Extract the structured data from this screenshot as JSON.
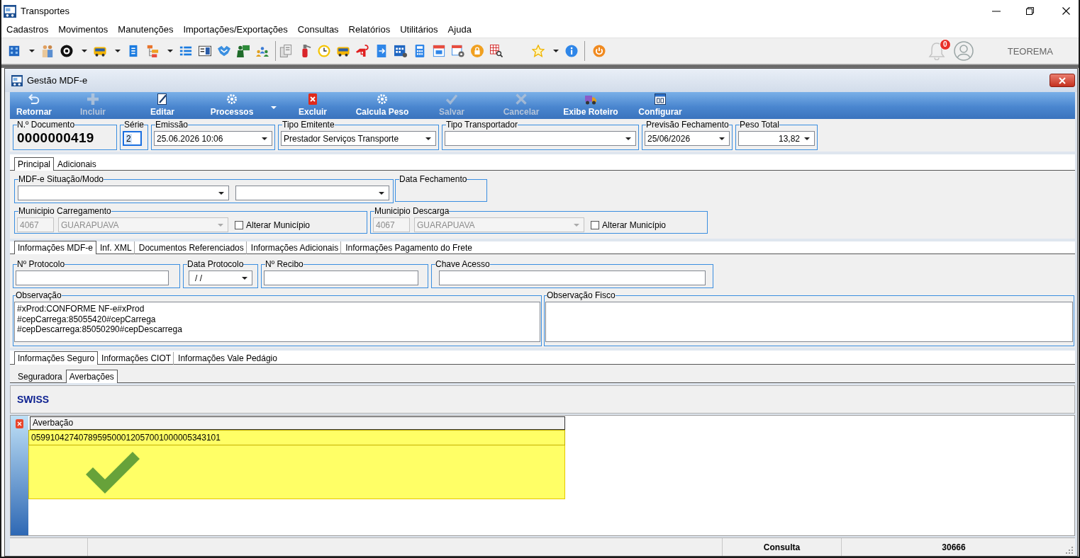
{
  "app": {
    "title": "Transportes",
    "menu": [
      "Cadastros",
      "Movimentos",
      "Manutenções",
      "Importações/Exportações",
      "Consultas",
      "Relatórios",
      "Utilitários",
      "Ajuda"
    ],
    "notification_count": "0",
    "user": "TEOREMA"
  },
  "window": {
    "title": "Gestão MDF-e"
  },
  "actions": [
    {
      "label": "Retornar",
      "kind": "button",
      "disabled": false
    },
    {
      "label": "Incluir",
      "kind": "button",
      "disabled": true
    },
    {
      "label": "Editar",
      "kind": "button",
      "disabled": false
    },
    {
      "label": "Processos",
      "kind": "menu",
      "disabled": false
    },
    {
      "label": "Excluir",
      "kind": "button",
      "disabled": false
    },
    {
      "label": "Calcula Peso",
      "kind": "button",
      "disabled": false
    },
    {
      "label": "Salvar",
      "kind": "button",
      "disabled": true
    },
    {
      "label": "Cancelar",
      "kind": "button",
      "disabled": true
    },
    {
      "label": "Exibe Roteiro",
      "kind": "button",
      "disabled": false
    },
    {
      "label": "Configurar",
      "kind": "button",
      "disabled": false
    }
  ],
  "header_fields": [
    {
      "label": "N.º Documento",
      "kind": "display",
      "value": "0000000419",
      "focused": false
    },
    {
      "label": "Série",
      "kind": "text",
      "value": "2",
      "focused": true
    },
    {
      "label": "Emissão",
      "kind": "combo",
      "value": "25.06.2026 10:06",
      "focused": false
    },
    {
      "label": "Tipo Emitente",
      "kind": "combo",
      "value": "Prestador Serviços Transporte",
      "focused": false
    },
    {
      "label": "Tipo Transportador",
      "kind": "combo",
      "focused": false
    },
    {
      "label": "Previsão Fechamento",
      "kind": "combo",
      "value": "25/06/2026",
      "focused": false
    },
    {
      "label": "Peso Total",
      "kind": "amount",
      "value": "13,82",
      "focused": false
    }
  ],
  "main_tabs": [
    {
      "label": "Principal",
      "selected": true
    },
    {
      "label": "Adicionais",
      "selected": false
    }
  ],
  "situacao": {
    "label": "MDF-e Situação/Modo",
    "dropdowns": [
      {
        "disabled": false
      },
      {
        "disabled": false
      }
    ]
  },
  "data_fechamento": {
    "label": "Data Fechamento"
  },
  "municipios": [
    {
      "label": "Municipio Carregamento",
      "code": "4067",
      "city": "GUARAPUAVA",
      "disabled": true,
      "option": {
        "label": "Alterar Município",
        "checked": false
      }
    },
    {
      "label": "Municipio Descarga",
      "code": "4067",
      "city": "GUARAPUAVA",
      "disabled": true,
      "option": {
        "label": "Alterar Município",
        "checked": false
      }
    }
  ],
  "info_tabs": [
    {
      "label": "Informações MDF-e",
      "selected": true
    },
    {
      "label": "Inf. XML",
      "selected": false
    },
    {
      "label": "Documentos Referenciados",
      "selected": false
    },
    {
      "label": "Informações Adicionais",
      "selected": false
    },
    {
      "label": "Informações Pagamento do Frete",
      "selected": false
    }
  ],
  "protocol_fields": [
    {
      "label": "Nº Protocolo",
      "kind": "text"
    },
    {
      "label": "Data Protocolo",
      "kind": "combo",
      "value": "/ /"
    },
    {
      "label": "Nº Recibo",
      "kind": "text"
    },
    {
      "label": "Chave Acesso",
      "kind": "text"
    }
  ],
  "notes": [
    {
      "label": "Observação",
      "lines": [
        "#xProd:CONFORME NF-e#xProd",
        "#cepCarrega:85055420#cepCarrega",
        "#cepDescarrega:85050290#cepDescarrega"
      ]
    },
    {
      "label": "Observação Fisco"
    }
  ],
  "seguro_tabs": [
    {
      "label": "Informações Seguro",
      "selected": true
    },
    {
      "label": "Informações CIOT",
      "selected": false
    },
    {
      "label": "Informações Vale Pedágio",
      "selected": false
    }
  ],
  "seguro_subtabs": [
    {
      "label": "Seguradora",
      "selected": false
    },
    {
      "label": "Averbações",
      "selected": true
    }
  ],
  "insurer": "SWISS",
  "averbacoes": {
    "columns": [
      "Averbação"
    ],
    "rows": [
      {
        "cells": [
          "0599104274078959500012057001000005343101"
        ],
        "selected": true
      }
    ],
    "checked": true
  },
  "status_bar": [
    "Consulta",
    "30666"
  ]
}
